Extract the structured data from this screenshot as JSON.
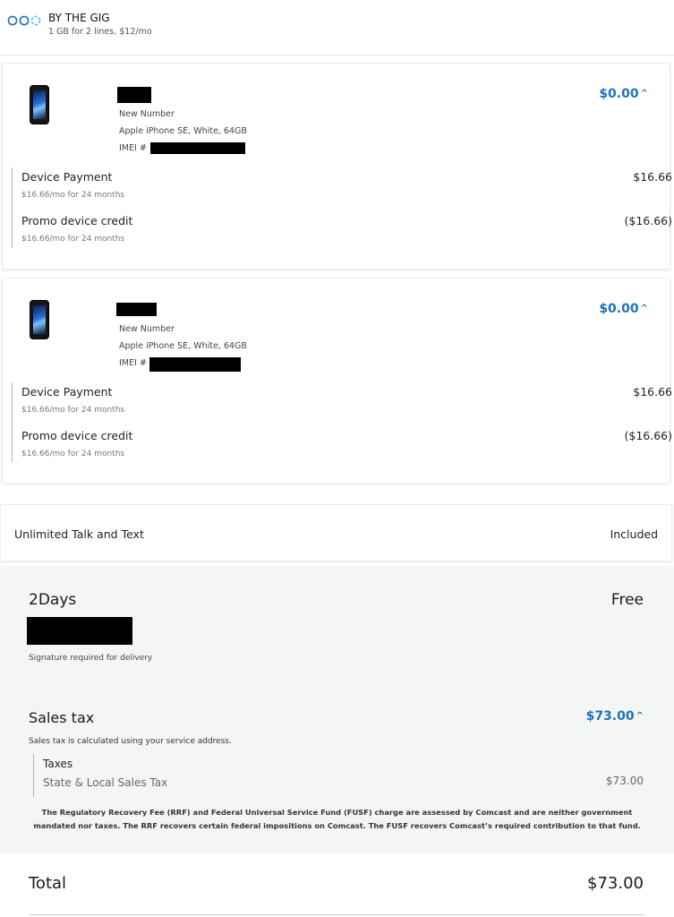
{
  "plan": {
    "title": "BY THE GIG",
    "subtitle": "1 GB for 2 lines, $12/mo",
    "icon": "three-circles-icon",
    "accent_color": "#1b73b8"
  },
  "devices": [
    {
      "line_status": "New Number",
      "model": "Apple iPhone SE, White, 64GB",
      "imei_label": "IMEI #",
      "total": "$0.00",
      "charges": [
        {
          "label": "Device Payment",
          "sub": "$16.66/mo for 24 months",
          "amount": "$16.66"
        },
        {
          "label": "Promo device credit",
          "sub": "$16.66/mo for 24 months",
          "amount": "($16.66)"
        }
      ]
    },
    {
      "line_status": "New Number",
      "model": "Apple iPhone SE, White, 64GB",
      "imei_label": "IMEI #",
      "total": "$0.00",
      "charges": [
        {
          "label": "Device Payment",
          "sub": "$16.66/mo for 24 months",
          "amount": "$16.66"
        },
        {
          "label": "Promo device credit",
          "sub": "$16.66/mo for 24 months",
          "amount": "($16.66)"
        }
      ]
    }
  ],
  "unlimited": {
    "label": "Unlimited Talk and Text",
    "value": "Included"
  },
  "shipping": {
    "name": "2Days",
    "cost": "Free",
    "note": "Signature required for delivery"
  },
  "tax": {
    "title": "Sales tax",
    "total": "$73.00",
    "note": "Sales tax is calculated using your service address.",
    "box_title": "Taxes",
    "box_sub": "State & Local Sales Tax",
    "box_amount": "$73.00",
    "fee_note": "The Regulatory Recovery Fee (RRF) and Federal Universal Service Fund (FUSF) charge are assessed by Comcast and are neither government mandated nor taxes. The RRF recovers certain federal impositions on Comcast. The FUSF recovers Comcast’s required contribution to that fund."
  },
  "total": {
    "label": "Total",
    "value": "$73.00"
  }
}
